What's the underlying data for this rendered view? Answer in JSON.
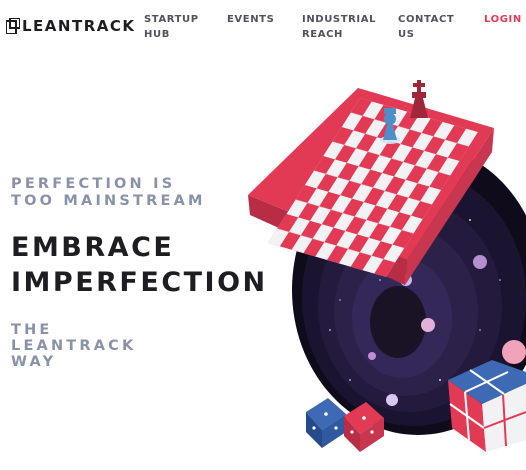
{
  "brand": {
    "name": "LEANTRACK"
  },
  "nav": {
    "startup_hub": "STARTUP HUB",
    "events": "EVENTS",
    "industrial_reach": "INDUSTRIAL REACH",
    "contact_us": "CONTACT US",
    "login": "LOGIN"
  },
  "hero": {
    "tagline": "PERFECTION IS TOO MAINSTREAM",
    "headline": "EMBRACE IMPERFECTION",
    "subline": "THE LEANTRACK WAY"
  },
  "colors": {
    "accent": "#e23a55",
    "text_dark": "#1e1e22",
    "text_muted": "#8a92a8",
    "nav_text": "#50535e",
    "board_red": "#e23a55",
    "space_dark": "#1a1428"
  },
  "icons": {
    "logo": "leantrack-logo-icon",
    "king": "king-piece-icon",
    "pawn": "pawn-piece-icon",
    "dice": "dice-icon",
    "cube": "puzzle-cube-icon"
  }
}
